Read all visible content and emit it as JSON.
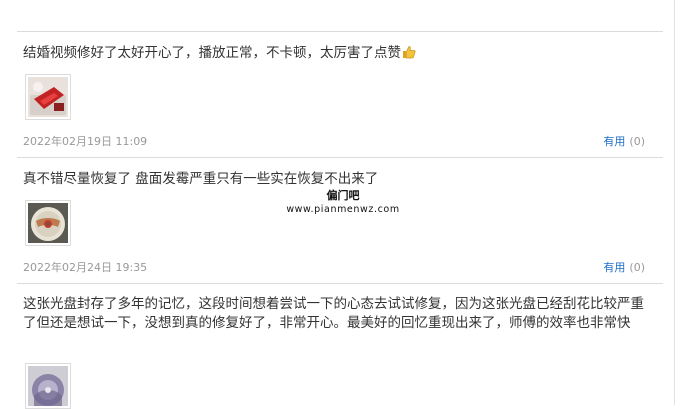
{
  "reviews": [
    {
      "text": "结婚视频修好了太好开心了，播放正常，不卡顿，太厉害了点赞",
      "date": "2022年02月19日 11:09",
      "useful_label": "有用",
      "useful_count": "(0)",
      "thumb_icon": "photo-red-box-icon",
      "emoji_icon": "thumbs-up-icon"
    },
    {
      "text": "真不错尽量恢复了 盘面发霉严重只有一些实在恢复不出来了",
      "date": "2022年02月24日 19:35",
      "useful_label": "有用",
      "useful_count": "(0)",
      "thumb_icon": "photo-disc-icon"
    },
    {
      "text": "这张光盘封存了多年的记忆，这段时间想着尝试一下的心态去试试修复，因为这张光盘已经刮花比较严重了但还是想试一下，没想到真的修复好了，非常开心。最美好的回忆重现出来了，师傅的效率也非常快",
      "thumb_icon": "photo-disc-purple-icon"
    }
  ],
  "watermark": {
    "title": "偏门吧",
    "url": "www.pianmenwz.com"
  },
  "colors": {
    "link": "#1e6ec8",
    "meta_text": "#999999",
    "divider": "#dcdcdc"
  }
}
